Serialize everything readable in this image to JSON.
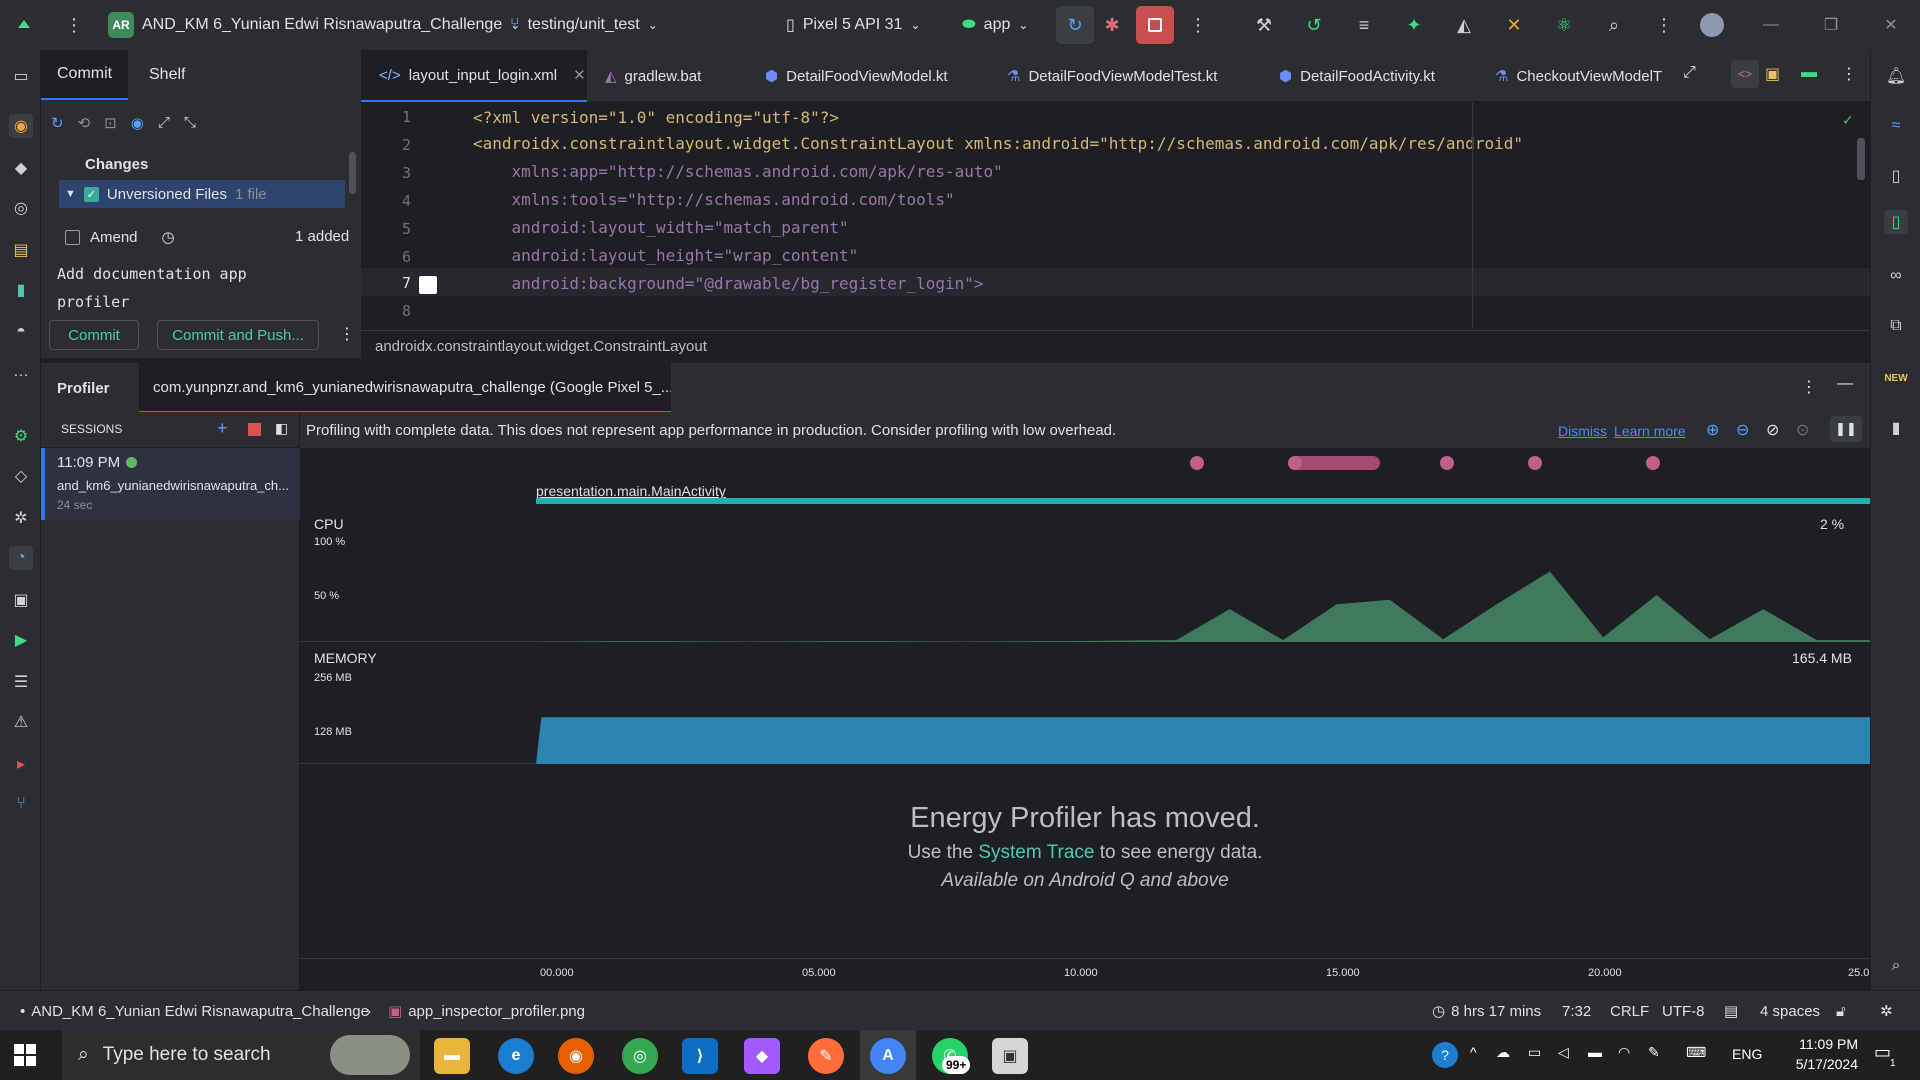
{
  "titlebar": {
    "project_badge": "AR",
    "project_name": "AND_KM 6_Yunian Edwi Risnawaputra_Challenge",
    "branch": "testing/unit_test",
    "device": "Pixel 5 API 31",
    "run_config": "app"
  },
  "commit_panel": {
    "tabs": [
      "Commit",
      "Shelf"
    ],
    "changes_label": "Changes",
    "unversioned_label": "Unversioned Files",
    "unversioned_count": "1 file",
    "amend_label": "Amend",
    "added_label": "1 added",
    "message_line1": "Add documentation app",
    "message_line2": "profiler",
    "commit_button": "Commit",
    "commit_push_button": "Commit and Push..."
  },
  "editor": {
    "tabs": [
      {
        "label": "layout_input_login.xml",
        "icon": "xml-icon"
      },
      {
        "label": "gradlew.bat",
        "icon": "gradle-icon"
      },
      {
        "label": "DetailFoodViewModel.kt",
        "icon": "kotlin-class-icon"
      },
      {
        "label": "DetailFoodViewModelTest.kt",
        "icon": "kotlin-test-icon"
      },
      {
        "label": "DetailFoodActivity.kt",
        "icon": "kotlin-class-icon"
      },
      {
        "label": "CheckoutViewModelT",
        "icon": "kotlin-test-icon"
      }
    ],
    "line_numbers": [
      "1",
      "2",
      "3",
      "4",
      "5",
      "6",
      "7",
      "8"
    ],
    "lines": [
      "<?xml version=\"1.0\" encoding=\"utf-8\"?>",
      "<androidx.constraintlayout.widget.ConstraintLayout xmlns:android=\"http://schemas.android.com/apk/res/android\"",
      "    xmlns:app=\"http://schemas.android.com/apk/res-auto\"",
      "    xmlns:tools=\"http://schemas.android.com/tools\"",
      "    android:layout_width=\"match_parent\"",
      "    android:layout_height=\"wrap_content\"",
      "    android:background=\"@drawable/bg_register_login\">",
      ""
    ],
    "breadcrumb": "androidx.constraintlayout.widget.ConstraintLayout"
  },
  "profiler": {
    "title": "Profiler",
    "session_tab": "com.yunpnzr.and_km6_yunianedwirisnawaputra_challenge (Google Pixel 5_...",
    "sessions_label": "SESSIONS",
    "session_time": "11:09 PM",
    "session_name": "and_km6_yunianedwirisnawaputra_ch...",
    "session_duration": "24 sec",
    "banner_text": "Profiling with complete data. This does not represent app performance in production. Consider profiling with low overhead.",
    "dismiss": "Dismiss",
    "learn_more": "Learn more",
    "activity_label": "presentation.main.MainActivity",
    "cpu_label": "CPU",
    "cpu_value": "2 %",
    "cpu_ticks": [
      "100 %",
      "50 %"
    ],
    "memory_label": "MEMORY",
    "memory_value": "165.4 MB",
    "memory_ticks": [
      "256 MB",
      "128 MB"
    ],
    "energy_title": "Energy Profiler has moved.",
    "energy_use": "Use the",
    "energy_link": "System Trace",
    "energy_rest": "to see energy data.",
    "energy_note": "Available on Android Q and above",
    "time_ticks": [
      "00.000",
      "05.000",
      "10.000",
      "15.000",
      "20.000",
      "25.0"
    ]
  },
  "statusbar": {
    "project": "AND_KM 6_Yunian Edwi Risnawaputra_Challenge",
    "file": "app_inspector_profiler.png",
    "time_tracked": "8 hrs 17 mins",
    "position": "7:32",
    "line_sep": "CRLF",
    "encoding": "UTF-8",
    "indent": "4 spaces"
  },
  "taskbar": {
    "search_placeholder": "Type here to search",
    "whatsapp_badge": "99+",
    "lang": "ENG",
    "time": "11:09 PM",
    "date": "5/17/2024",
    "notif_count": "1"
  },
  "chart_data": [
    {
      "type": "area",
      "title": "CPU",
      "ylabel": "CPU %",
      "ylim": [
        0,
        100
      ],
      "x": [
        0,
        2,
        4,
        6,
        8,
        10,
        12,
        13,
        14,
        15,
        16,
        17,
        18,
        19,
        20,
        21,
        22,
        23,
        24,
        25
      ],
      "values": [
        0,
        1,
        0,
        1,
        0,
        1,
        2,
        35,
        2,
        40,
        45,
        3,
        40,
        75,
        5,
        50,
        3,
        35,
        2,
        2
      ]
    },
    {
      "type": "area",
      "title": "MEMORY",
      "ylabel": "MB",
      "ylim": [
        0,
        256
      ],
      "x": [
        0,
        0.1,
        25
      ],
      "values": [
        0,
        130,
        130
      ]
    }
  ],
  "colors": {
    "accent": "#3574f0",
    "cpu_fill": "#3f7a5f",
    "memory_fill": "#2c85b0",
    "activity_bar": "#20b2aa",
    "event_dot": "#c0608a",
    "link_green": "#4ec9b0"
  }
}
